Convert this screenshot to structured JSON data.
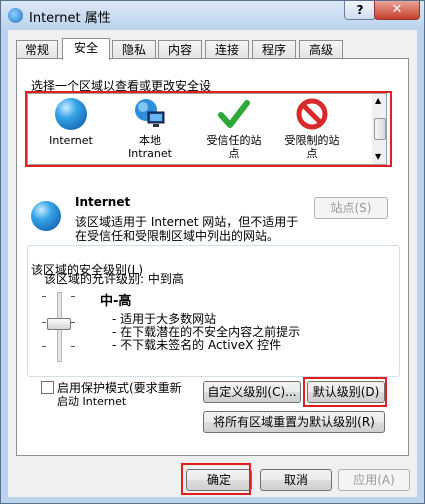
{
  "window": {
    "title": "Internet 属性",
    "help_label": "?",
    "close_label": "✕"
  },
  "tabs": [
    {
      "label": "常规"
    },
    {
      "label": "安全"
    },
    {
      "label": "隐私"
    },
    {
      "label": "内容"
    },
    {
      "label": "连接"
    },
    {
      "label": "程序"
    },
    {
      "label": "高级"
    }
  ],
  "active_tab": "安全",
  "zones": {
    "heading": "选择一个区域以查看或更改安全设",
    "items": [
      {
        "line1": "Internet",
        "line2": "",
        "icon": "globe-icon"
      },
      {
        "line1": "本地",
        "line2": "Intranet",
        "icon": "local-intranet-icon"
      },
      {
        "line1": "受信任的站",
        "line2": "点",
        "icon": "checkmark-icon"
      },
      {
        "line1": "受限制的站",
        "line2": "点",
        "icon": "restricted-icon"
      }
    ]
  },
  "zone_info": {
    "title": "Internet",
    "desc_line1": "该区域适用于 Internet 网站，但不适用于",
    "desc_line2": "在受信任和受限制区域中列出的网站。",
    "sites_button": "站点(S)"
  },
  "security_level": {
    "group_label": "该区域的安全级别(L)",
    "allowed_levels": "该区域的允许级别: 中到高",
    "level_name": "中-高",
    "bullets": [
      "- 适用于大多数网站",
      "- 在下载潜在的不安全内容之前提示",
      "- 不下载未签名的 ActiveX 控件"
    ],
    "protected_mode_line1": "启用保护模式(要求重新",
    "protected_mode_line2": "启动 Internet",
    "custom_level_button": "自定义级别(C)...",
    "default_level_button": "默认级别(D)",
    "reset_all_button": "将所有区域重置为默认级别(R)"
  },
  "footer": {
    "ok_button": "确定",
    "cancel_button": "取消",
    "apply_button": "应用(A)"
  },
  "colors": {
    "highlight": "#e02020",
    "title_bar": "#bcd3ee"
  }
}
